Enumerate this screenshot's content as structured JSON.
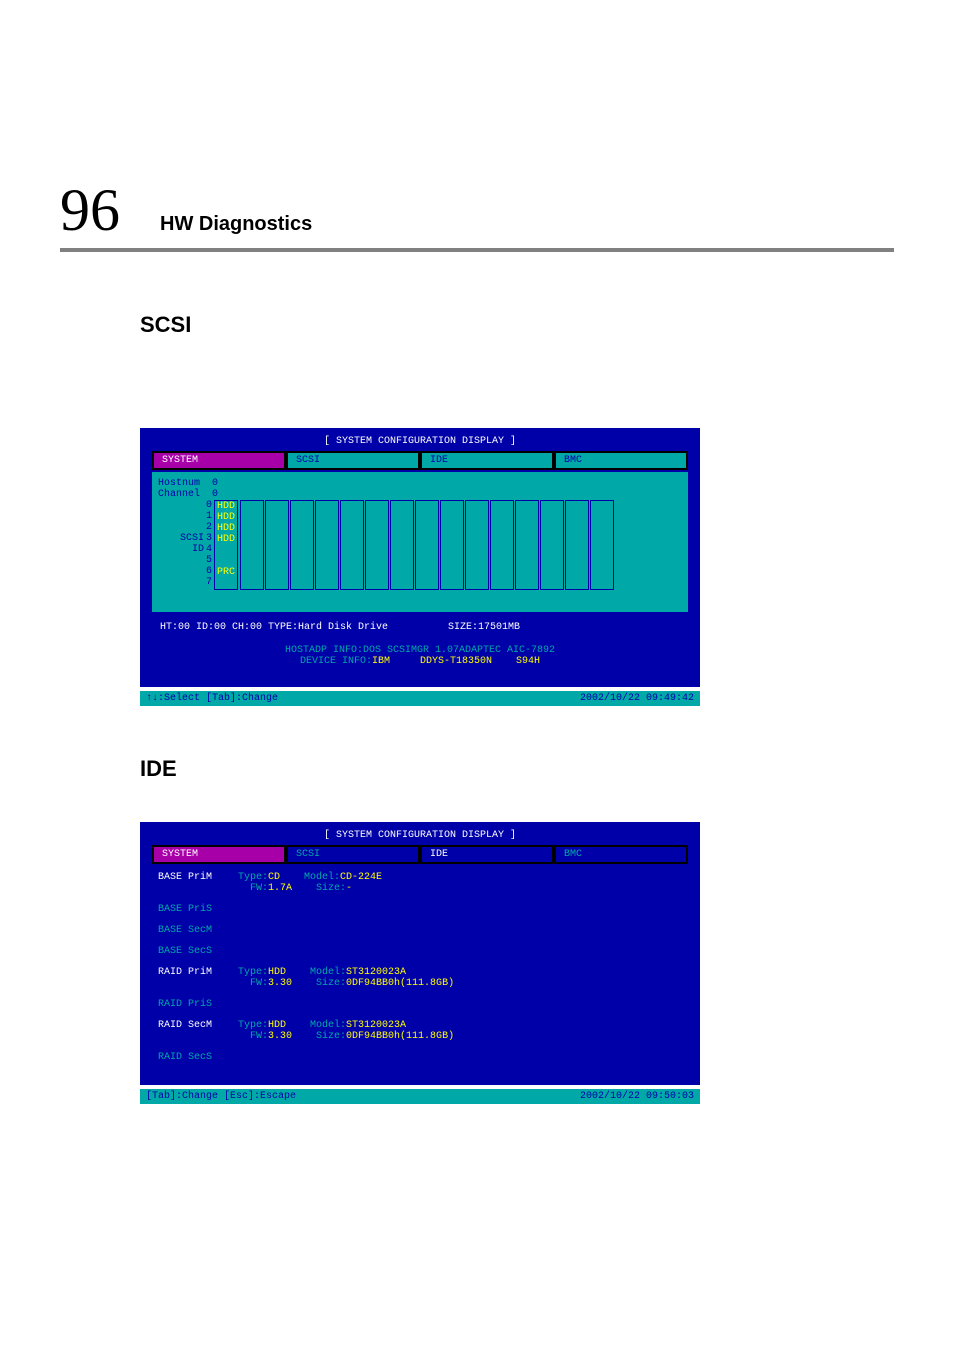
{
  "header": {
    "page_number": "96",
    "title": "HW Diagnostics"
  },
  "sections": {
    "scsi_heading": "SCSI",
    "ide_heading": "IDE"
  },
  "scsi": {
    "window_title": "[ SYSTEM CONFIGURATION DISPLAY ]",
    "tabs": {
      "system": "SYSTEM",
      "scsi": "SCSI",
      "ide": "IDE",
      "bmc": "BMC"
    },
    "hostnum_label": "Hostnum",
    "hostnum_value": "0",
    "channel_label": "Channel",
    "channel_value": "0",
    "scsi_id_label": "SCSI\n ID",
    "rows": [
      "0",
      "1",
      "2",
      "3",
      "4",
      "5",
      "6",
      "7"
    ],
    "slot_values": {
      "0": "HDD",
      "1": "HDD",
      "2": "HDD",
      "3": "HDD",
      "4": "",
      "5": "",
      "6": "PRC",
      "7": ""
    },
    "status_line": "HT:00 ID:00 CH:00 TYPE:Hard Disk Drive          SIZE:17501MB",
    "hostadp_line": "HOSTADP INFO:DOS SCSIMGR 1.07ADAPTEC AIC-7892",
    "device_line_label": "DEVICE  INFO:",
    "device_vendor": "IBM",
    "device_model": "DDYS-T18350N",
    "device_rev": "S94H",
    "footer_left": "↑↓:Select [Tab]:Change",
    "footer_right": "2002/10/22 09:49:42"
  },
  "ide": {
    "window_title": "[ SYSTEM CONFIGURATION DISPLAY ]",
    "tabs": {
      "system": "SYSTEM",
      "scsi": "SCSI",
      "ide": "IDE",
      "bmc": "BMC"
    },
    "channels": [
      {
        "name": "BASE PriM",
        "active": true,
        "type": "CD",
        "fw": "1.7A",
        "model": "CD-224E",
        "size": "-"
      },
      {
        "name": "BASE PriS",
        "active": false
      },
      {
        "name": "BASE SecM",
        "active": false
      },
      {
        "name": "BASE SecS",
        "active": false
      },
      {
        "name": "RAID PriM",
        "active": true,
        "type": "HDD",
        "fw": "3.30",
        "model": "ST3120023A",
        "size": "0DF94BB0h(111.8GB)"
      },
      {
        "name": "RAID PriS",
        "active": false
      },
      {
        "name": "RAID SecM",
        "active": true,
        "type": "HDD",
        "fw": "3.30",
        "model": "ST3120023A",
        "size": "0DF94BB0h(111.8GB)"
      },
      {
        "name": "RAID SecS",
        "active": false
      }
    ],
    "labels": {
      "type": "Type:",
      "fw": "FW:",
      "model": "Model:",
      "size": "Size:"
    },
    "footer_left": "[Tab]:Change [Esc]:Escape",
    "footer_right": "2002/10/22 09:50:03"
  }
}
